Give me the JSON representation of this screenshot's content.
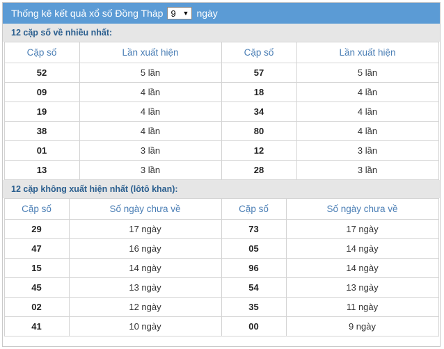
{
  "header": {
    "prefix": "Thống kê kết quả xổ số Đồng Tháp",
    "days_value": "9",
    "suffix": "ngày"
  },
  "section1": {
    "title": "12 cặp số về nhiều nhất:",
    "headers": [
      "Cặp số",
      "Lần xuất hiện",
      "Cặp số",
      "Lần xuất hiện"
    ],
    "rows": [
      [
        "52",
        "5 lần",
        "57",
        "5 lần"
      ],
      [
        "09",
        "4 lần",
        "18",
        "4 lần"
      ],
      [
        "19",
        "4 lần",
        "34",
        "4 lần"
      ],
      [
        "38",
        "4 lần",
        "80",
        "4 lần"
      ],
      [
        "01",
        "3 lần",
        "12",
        "3 lần"
      ],
      [
        "13",
        "3 lần",
        "28",
        "3 lần"
      ]
    ]
  },
  "section2": {
    "title": "12 cặp không xuất hiện nhất (lôtô khan):",
    "headers": [
      "Cặp số",
      "Số ngày chưa về",
      "Cặp số",
      "Số ngày chưa về"
    ],
    "rows": [
      [
        "29",
        "17 ngày",
        "73",
        "17 ngày"
      ],
      [
        "47",
        "16 ngày",
        "05",
        "14 ngày"
      ],
      [
        "15",
        "14 ngày",
        "96",
        "14 ngày"
      ],
      [
        "45",
        "13 ngày",
        "54",
        "13 ngày"
      ],
      [
        "02",
        "12 ngày",
        "35",
        "11 ngày"
      ],
      [
        "41",
        "10 ngày",
        "00",
        "9 ngày"
      ]
    ]
  }
}
